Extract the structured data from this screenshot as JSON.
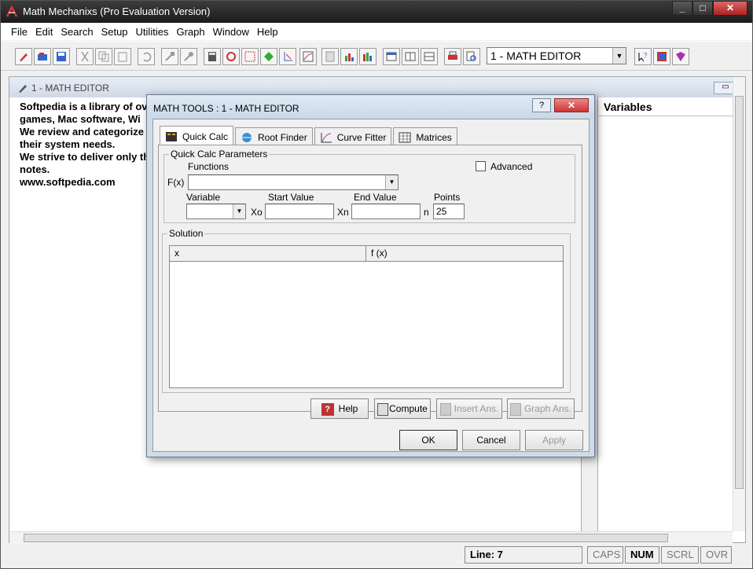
{
  "window": {
    "title": "Math Mechanixs (Pro Evaluation Version)"
  },
  "menu": {
    "items": [
      "File",
      "Edit",
      "Search",
      "Setup",
      "Utilities",
      "Graph",
      "Window",
      "Help"
    ]
  },
  "toolbar": {
    "document_combo": "1 - MATH EDITOR"
  },
  "child": {
    "title": "1 - MATH EDITOR",
    "editor_lines": [
      "Softpedia is a library of ov",
      "games, Mac software, Wi",
      "We review and categorize",
      "their system needs.",
      "We strive to deliver only th",
      "notes.",
      "www.softpedia.com"
    ],
    "variables_header": "Variables"
  },
  "status": {
    "line": "Line: 7",
    "caps": "CAPS",
    "num": "NUM",
    "scrl": "SCRL",
    "ovr": "OVR"
  },
  "dialog": {
    "title": "MATH TOOLS : 1 - MATH EDITOR",
    "help_glyph": "?",
    "close_glyph": "✕",
    "tabs": [
      "Quick Calc",
      "Root Finder",
      "Curve Fitter",
      "Matrices"
    ],
    "params": {
      "legend": "Quick Calc Parameters",
      "functions_label": "Functions",
      "fx_label": "F(x)",
      "fx_value": "",
      "advanced_label": "Advanced",
      "variable_label": "Variable",
      "variable_value": "",
      "start_label": "Start Value",
      "end_label": "End Value",
      "points_label": "Points",
      "xo_label": "Xo",
      "xn_label": "Xn",
      "n_label": "n",
      "start_value": "",
      "end_value": "",
      "points_value": "25"
    },
    "solution": {
      "legend": "Solution",
      "col_x": "x",
      "col_fx": "f (x)"
    },
    "buttons": {
      "help": "Help",
      "compute": "Compute",
      "insert": "Insert Ans.",
      "graph": "Graph Ans.",
      "ok": "OK",
      "cancel": "Cancel",
      "apply": "Apply"
    }
  }
}
